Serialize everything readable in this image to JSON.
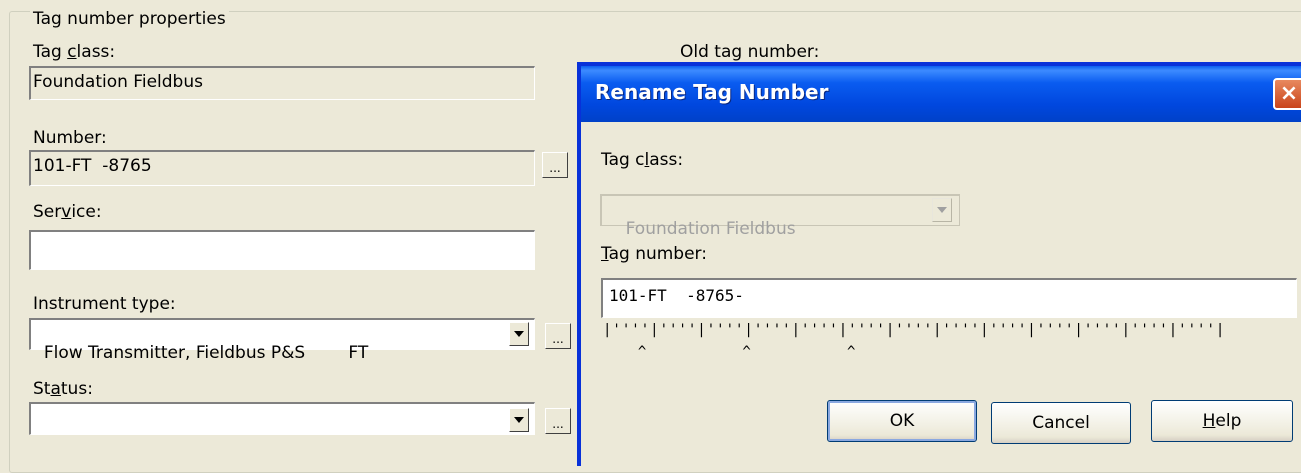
{
  "props": {
    "group_title": "Tag number properties",
    "tag_class_label": "Tag class:",
    "tag_class_value": "Foundation Fieldbus",
    "old_tag_number_label": "Old tag number:",
    "number_label": "Number:",
    "number_value": "101-FT  -8765",
    "service_label": "Service:",
    "service_value": "",
    "instrument_type_label": "Instrument type:",
    "instrument_type_value": "Flow Transmitter, Fieldbus P&S        FT",
    "status_label": "Status:",
    "status_value": "",
    "ellipsis": "..."
  },
  "dialog": {
    "title": "Rename Tag Number",
    "close_label": "×",
    "tag_class_label": "Tag class:",
    "tag_class_value": "Foundation Fieldbus",
    "tag_number_label": "Tag number:",
    "tag_number_value": "101-FT  -8765-",
    "ruler": "|''''|''''|''''|''''|''''|''''|''''|''''|''''|''''|''''|''''|''''|",
    "carets": "  ^     ^     ^",
    "ok_label": "OK",
    "cancel_label": "Cancel",
    "help_label": "Help"
  },
  "colors": {
    "face": "#ECE9D8",
    "title_blue": "#0047DE",
    "close_red": "#C9441A"
  }
}
